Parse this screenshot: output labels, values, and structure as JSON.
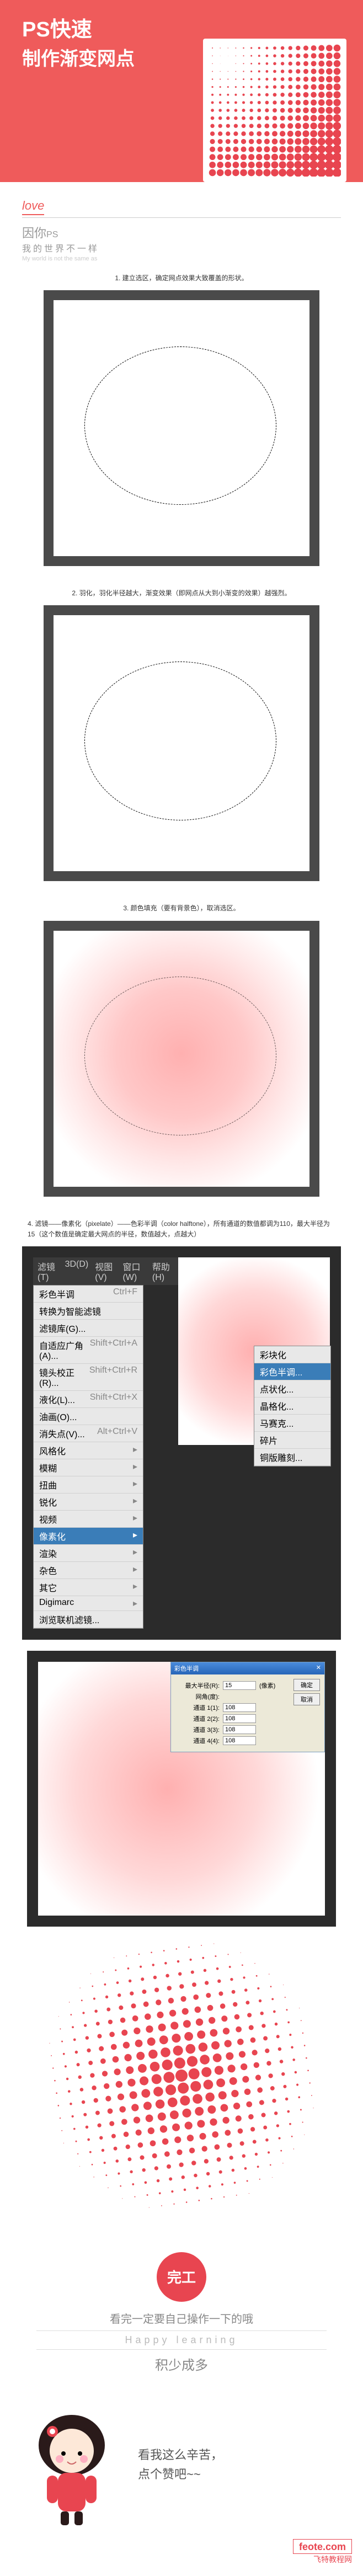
{
  "header": {
    "title_line1": "PS快速",
    "title_line2": "制作渐变网点"
  },
  "love": {
    "label": "love",
    "cn_prefix": "因你",
    "cn_suffix": "PS",
    "sub": "我的世界不一样",
    "en": "My world is not the same as"
  },
  "steps": {
    "s1": "1. 建立选区，确定网点效果大致覆盖的形状。",
    "s2": "2. 羽化，羽化半径越大，渐变效果（即网点从大到小渐变的效果）越强烈。",
    "s3": "3. 颜色填充（要有背景色），取消选区。",
    "s4": "4. 滤镜——像素化（pixelate）——色彩半调（color halftone），所有通道的数值都调为110，最大半径为15（这个数值是确定最大网点的半径，数值越大，点越大）"
  },
  "menu": {
    "top": [
      "滤镜(T)",
      "3D(D)",
      "视图(V)",
      "窗口(W)",
      "帮助(H)"
    ],
    "items": [
      {
        "label": "彩色半调",
        "shortcut": "Ctrl+F"
      },
      {
        "label": "转换为智能滤镜",
        "shortcut": ""
      },
      {
        "label": "滤镜库(G)...",
        "shortcut": ""
      },
      {
        "label": "自适应广角(A)...",
        "shortcut": "Shift+Ctrl+A"
      },
      {
        "label": "镜头校正(R)...",
        "shortcut": "Shift+Ctrl+R"
      },
      {
        "label": "液化(L)...",
        "shortcut": "Shift+Ctrl+X"
      },
      {
        "label": "油画(O)...",
        "shortcut": ""
      },
      {
        "label": "消失点(V)...",
        "shortcut": "Alt+Ctrl+V"
      },
      {
        "label": "风格化",
        "shortcut": "▸"
      },
      {
        "label": "模糊",
        "shortcut": "▸"
      },
      {
        "label": "扭曲",
        "shortcut": "▸"
      },
      {
        "label": "锐化",
        "shortcut": "▸"
      },
      {
        "label": "视频",
        "shortcut": "▸"
      },
      {
        "label": "像素化",
        "shortcut": "▸",
        "hl": true
      },
      {
        "label": "渲染",
        "shortcut": "▸"
      },
      {
        "label": "杂色",
        "shortcut": "▸"
      },
      {
        "label": "其它",
        "shortcut": "▸"
      },
      {
        "label": "Digimarc",
        "shortcut": "▸"
      },
      {
        "label": "浏览联机滤镜...",
        "shortcut": ""
      }
    ],
    "submenu": [
      "彩块化",
      "彩色半调...",
      "点状化...",
      "晶格化...",
      "马赛克...",
      "碎片",
      "铜版雕刻..."
    ],
    "submenu_hl": 1
  },
  "dialog": {
    "title": "彩色半调",
    "close": "✕",
    "max_radius_label": "最大半径(R):",
    "max_radius_value": "15",
    "px": "(像素)",
    "angle_label": "网角(度):",
    "channels": [
      {
        "label": "通道 1(1):",
        "value": "108"
      },
      {
        "label": "通道 2(2):",
        "value": "108"
      },
      {
        "label": "通道 3(3):",
        "value": "108"
      },
      {
        "label": "通道 4(4):",
        "value": "108"
      }
    ],
    "ok": "确定",
    "cancel": "取消"
  },
  "done": {
    "badge": "完工",
    "text": "看完一定要自己操作一下的哦",
    "happy": "Happy learning",
    "accum": "积少成多"
  },
  "footer": {
    "char_text1": "看我这么辛苦，",
    "char_text2": "点个赞吧~~",
    "site": "feote.com",
    "site_cn": "飞特教程网"
  }
}
